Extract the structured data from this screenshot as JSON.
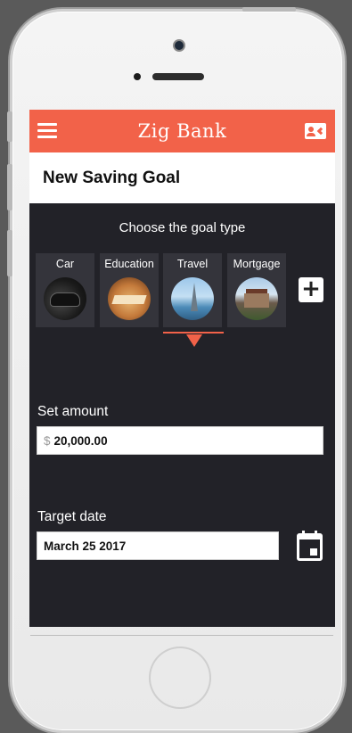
{
  "app": {
    "title": "Zig Bank"
  },
  "page": {
    "title": "New Saving Goal"
  },
  "goal_section": {
    "title": "Choose the goal type"
  },
  "goal_types": [
    {
      "label": "Car",
      "image": "car-photo"
    },
    {
      "label": "Education",
      "image": "books-photo"
    },
    {
      "label": "Travel",
      "image": "travel-landmarks-photo",
      "selected": true
    },
    {
      "label": "Mortgage",
      "image": "house-photo"
    }
  ],
  "amount": {
    "label": "Set amount",
    "currency": "$",
    "value": "20,000.00"
  },
  "target_date": {
    "label": "Target date",
    "value": "March 25 2017"
  },
  "icons": {
    "menu": "hamburger-menu-icon",
    "contact": "contact-card-icon",
    "add": "plus-icon",
    "calendar": "calendar-icon"
  },
  "colors": {
    "accent": "#f26249",
    "panel": "#222228",
    "tile": "#34343b"
  }
}
